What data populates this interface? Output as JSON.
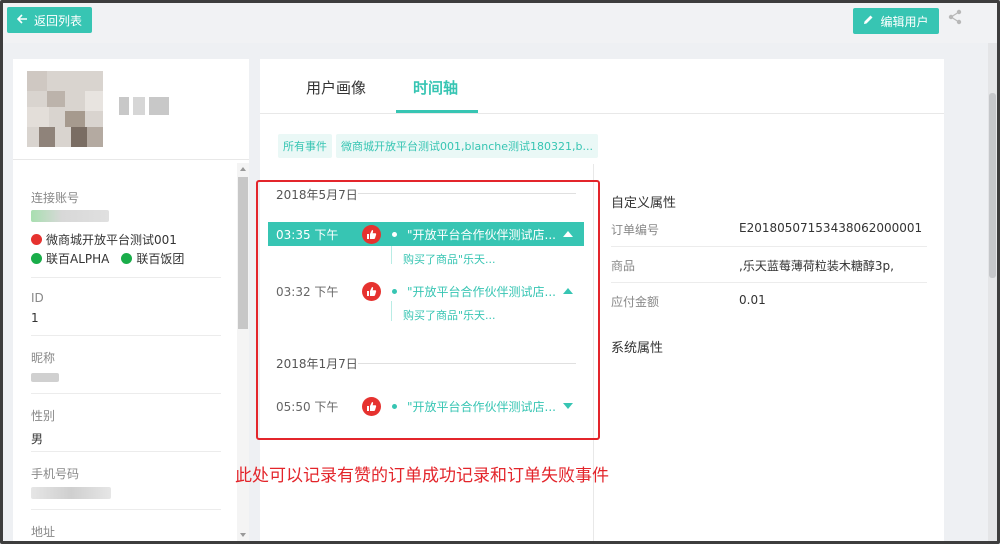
{
  "toolbar": {
    "back_label": "返回列表",
    "edit_label": "编辑用户"
  },
  "profile": {
    "fields": [
      {
        "label": "连接账号"
      },
      {
        "label": "ID",
        "value": "1"
      },
      {
        "label": "昵称"
      },
      {
        "label": "性别",
        "value": "男"
      },
      {
        "label": "手机号码"
      },
      {
        "label": "地址"
      }
    ],
    "accounts": {
      "weibo_store": "微商城开放平台测试001",
      "alpha": "联百ALPHA",
      "group": "联百饭团"
    }
  },
  "tabs": [
    {
      "label": "用户画像",
      "active": false
    },
    {
      "label": "时间轴",
      "active": true
    }
  ],
  "filters": [
    "所有事件",
    "微商城开放平台测试001,blanche测试180321,b..."
  ],
  "timeline": {
    "groups": [
      {
        "date": "2018年5月7日",
        "events": [
          {
            "time": "03:35 下午",
            "title": "\"开放平台合作伙伴测试店...",
            "subtitle": "购买了商品\"乐天...",
            "expanded": true,
            "selected": true
          },
          {
            "time": "03:32 下午",
            "title": "\"开放平台合作伙伴测试店...",
            "subtitle": "购买了商品\"乐天...",
            "expanded": true,
            "selected": false
          }
        ]
      },
      {
        "date": "2018年1月7日",
        "events": [
          {
            "time": "05:50 下午",
            "title": "\"开放平台合作伙伴测试店...",
            "expanded": false,
            "selected": false
          }
        ]
      }
    ]
  },
  "properties": {
    "custom_title": "自定义属性",
    "rows": [
      {
        "key": "订单编号",
        "value": "E20180507153438062000001"
      },
      {
        "key": "商品",
        "value": ",乐天蓝莓薄荷粒装木糖醇3p,"
      },
      {
        "key": "应付金额",
        "value": "0.01"
      }
    ],
    "system_title": "系统属性"
  },
  "annotation": "此处可以记录有赞的订单成功记录和订单失败事件",
  "colors": {
    "accent": "#37c5b3",
    "like_red": "#e6322f",
    "annotation_red": "#e3252b",
    "wechat_green": "#1aad4a"
  }
}
